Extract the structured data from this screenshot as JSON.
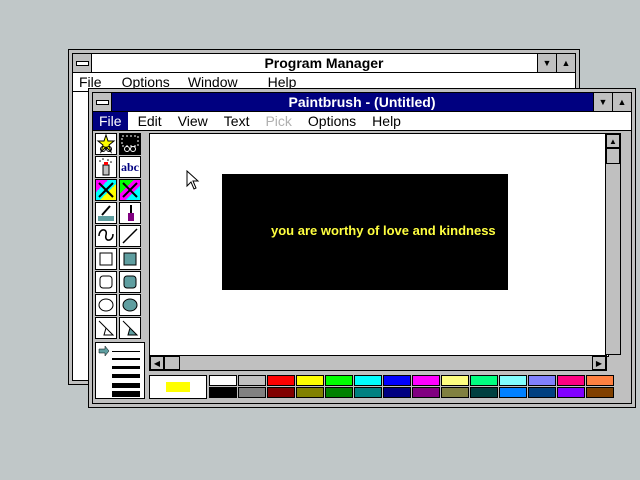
{
  "program_manager": {
    "title": "Program Manager",
    "menu": [
      "File",
      "Options",
      "Window",
      "Help"
    ]
  },
  "paintbrush": {
    "title": "Paintbrush - (Untitled)",
    "menu": [
      {
        "label": "File",
        "selected": true,
        "disabled": false
      },
      {
        "label": "Edit",
        "selected": false,
        "disabled": false
      },
      {
        "label": "View",
        "selected": false,
        "disabled": false
      },
      {
        "label": "Text",
        "selected": false,
        "disabled": false
      },
      {
        "label": "Pick",
        "selected": false,
        "disabled": true
      },
      {
        "label": "Options",
        "selected": false,
        "disabled": false
      },
      {
        "label": "Help",
        "selected": false,
        "disabled": false
      }
    ],
    "canvas_text": "you are worthy of love and kindness",
    "text_tool_label": "abc",
    "foreground_color": "#ffff00",
    "background_color": "#ffffff",
    "canvas_text_color": "#ffff40",
    "palette_top": [
      "#ffffff",
      "#c0c0c0",
      "#ff0000",
      "#ffff00",
      "#00ff00",
      "#00ffff",
      "#0000ff",
      "#ff00ff",
      "#ffff80",
      "#00ff80",
      "#80ffff",
      "#8080ff",
      "#ff0080",
      "#ff8040"
    ],
    "palette_bottom": [
      "#000000",
      "#808080",
      "#800000",
      "#808000",
      "#008000",
      "#008080",
      "#000080",
      "#800080",
      "#808040",
      "#004040",
      "#0080ff",
      "#004080",
      "#8000ff",
      "#804000"
    ]
  }
}
